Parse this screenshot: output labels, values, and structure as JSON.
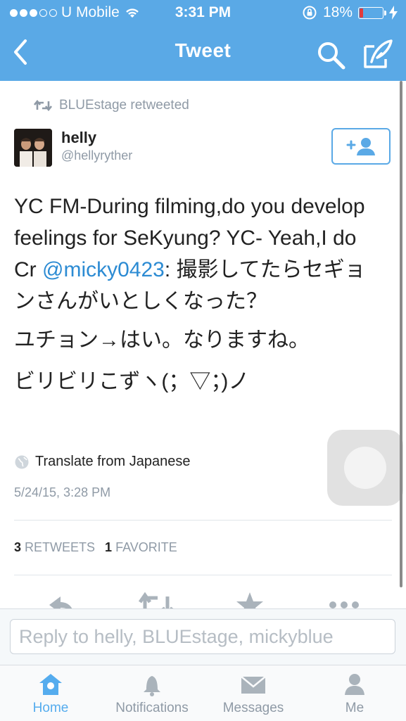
{
  "status_bar": {
    "carrier": "U Mobile",
    "time": "3:31 PM",
    "battery": "18%"
  },
  "nav": {
    "title": "Tweet"
  },
  "tweet": {
    "retweeted_by": "BLUEstage retweeted",
    "author_name": "helly",
    "author_handle": "@hellyryther",
    "text_line1_a": "YC FM-During filming,do you develop feelings for SeKyung? YC- Yeah,I do Cr ",
    "mention": "@micky0423",
    "text_line1_b": ": 撮影してたらセギョンさんがいとしくなった？",
    "text_line2": "ユチョン→はい。なりますね。",
    "text_line3": "ビリビリこずヽ(；▽；)ノ",
    "translate": "Translate from Japanese",
    "timestamp": "5/24/15, 3:28 PM",
    "retweets_count": "3",
    "retweets_label": "RETWEETS",
    "favorites_count": "1",
    "favorites_label": "FAVORITE"
  },
  "reply": {
    "placeholder": "Reply to helly, BLUEstage, mickyblue"
  },
  "tabs": [
    {
      "label": "Home",
      "icon": "home-icon",
      "active": true
    },
    {
      "label": "Notifications",
      "icon": "bell-icon",
      "active": false
    },
    {
      "label": "Messages",
      "icon": "envelope-icon",
      "active": false
    },
    {
      "label": "Me",
      "icon": "person-icon",
      "active": false
    }
  ],
  "colors": {
    "brand_blue": "#5aa9e6",
    "link_blue": "#2c8bd3",
    "muted_gray": "#8f9aa6",
    "battery_low": "#e23b3b"
  }
}
